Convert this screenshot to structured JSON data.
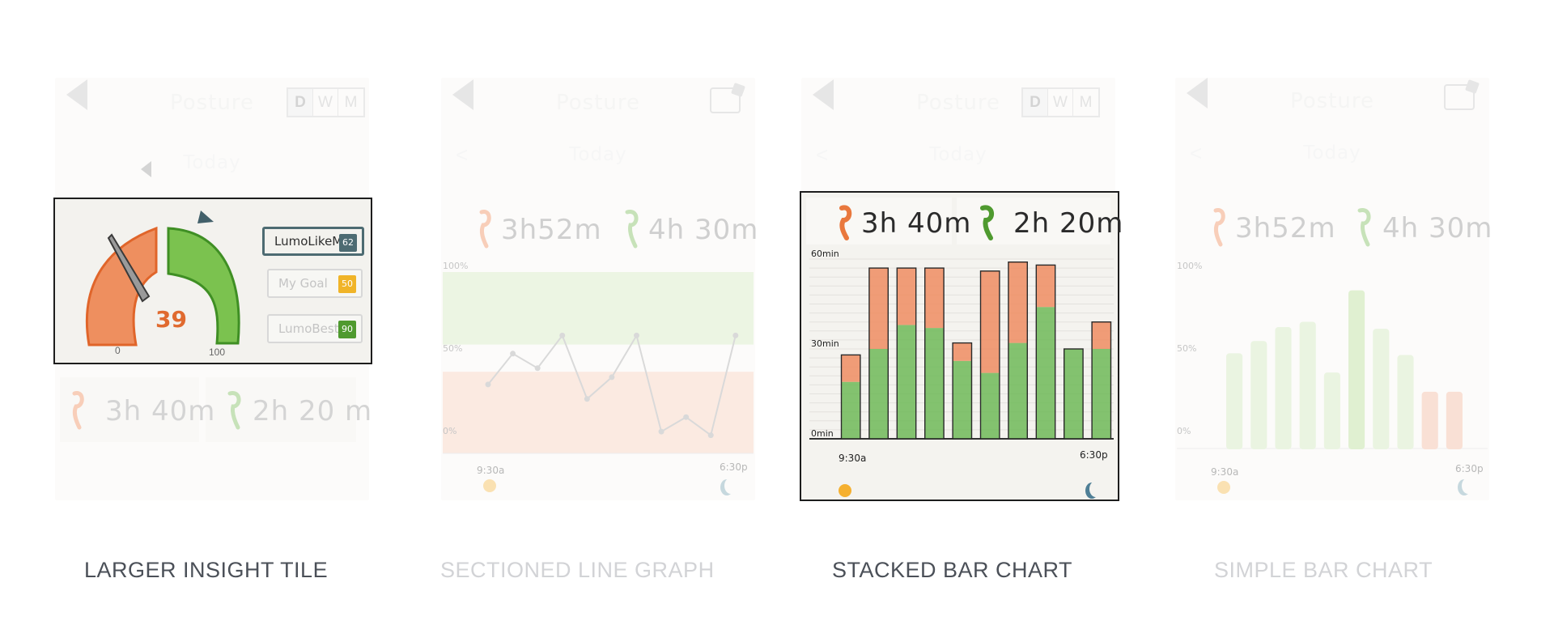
{
  "panels": [
    {
      "caption": "LARGER INSIGHT TILE",
      "header_title": "Posture",
      "view_toggle": [
        "D",
        "W",
        "M"
      ],
      "nav_title": "Today",
      "gauge": {
        "value_label": "39",
        "min_label": "0",
        "max_label": "100",
        "value": 39,
        "bad_color": "#e9783d",
        "good_color": "#6bb33f"
      },
      "badges": [
        {
          "label": "LumoLikeMe",
          "value": "62",
          "color": "#4d6b72"
        },
        {
          "label": "My Goal",
          "value": "50",
          "color": "#f0b428"
        },
        {
          "label": "LumoBest",
          "value": "90",
          "color": "#4f9a2f"
        }
      ],
      "stats": {
        "bad": "3h 40m",
        "good": "2h 20 m"
      }
    },
    {
      "caption": "SECTIONED LINE GRAPH",
      "header_title": "Posture",
      "nav_title": "Today",
      "stats": {
        "bad": "3h52m",
        "good": "4h 30m"
      },
      "y_labels": [
        "100%",
        "50%",
        "0%"
      ],
      "x_labels": [
        "9:30a",
        "6:30p"
      ]
    },
    {
      "caption": "STACKED BAR CHART",
      "header_title": "Posture",
      "view_toggle": [
        "D",
        "W",
        "M"
      ],
      "nav_title": "Today",
      "stats": {
        "bad": "3h 40m",
        "good": "2h 20m"
      }
    },
    {
      "caption": "SIMPLE BAR CHART",
      "header_title": "Posture",
      "nav_title": "Today",
      "stats": {
        "bad": "3h52m",
        "good": "4h 30m"
      },
      "y_labels": [
        "100%",
        "50%",
        "0%"
      ],
      "x_labels": [
        "9:30a",
        "6:30p"
      ]
    }
  ],
  "chart_data": [
    {
      "type": "line",
      "title": "",
      "x_labels": [
        "9:30a",
        "6:30p"
      ],
      "y_ticks": [
        "100%",
        "50%",
        "0%"
      ],
      "ylim": [
        0,
        100
      ],
      "values": [
        38,
        55,
        47,
        65,
        30,
        42,
        65,
        12,
        20,
        10,
        65
      ],
      "bands": [
        {
          "range": [
            60,
            100
          ],
          "color": "#cfe6b8"
        },
        {
          "range": [
            0,
            45
          ],
          "color": "#f6c9b4"
        }
      ],
      "line_color": "#a7a7a7"
    },
    {
      "type": "bar",
      "title": "",
      "x_labels": [
        "9:30a",
        "6:30p"
      ],
      "y_ticks": [
        "60min",
        "30min",
        "0min"
      ],
      "ylim": [
        0,
        60
      ],
      "series": [
        {
          "color": "#6fb858",
          "values": [
            19,
            30,
            38,
            37,
            26,
            22,
            32,
            44,
            30,
            30
          ]
        },
        {
          "color": "#ee8c62",
          "values": [
            9,
            27,
            19,
            20,
            6,
            34,
            27,
            14,
            0,
            9
          ]
        }
      ],
      "bad_color": "#ee8c62",
      "good_color": "#6fb858"
    },
    {
      "type": "bar",
      "title": "",
      "x_labels": [
        "9:30a",
        "6:30p"
      ],
      "y_ticks": [
        "100%",
        "50%",
        "0%"
      ],
      "ylim": [
        0,
        100
      ],
      "values": [
        54,
        61,
        69,
        72,
        43,
        90,
        68,
        53,
        32,
        32
      ],
      "colors": [
        "#cfe6b8",
        "#cfe6b8",
        "#cfe6b8",
        "#cfe6b8",
        "#cfe6b8",
        "#b6dc94",
        "#cfe6b8",
        "#cfe6b8",
        "#f3b79c",
        "#f3b79c"
      ]
    }
  ]
}
